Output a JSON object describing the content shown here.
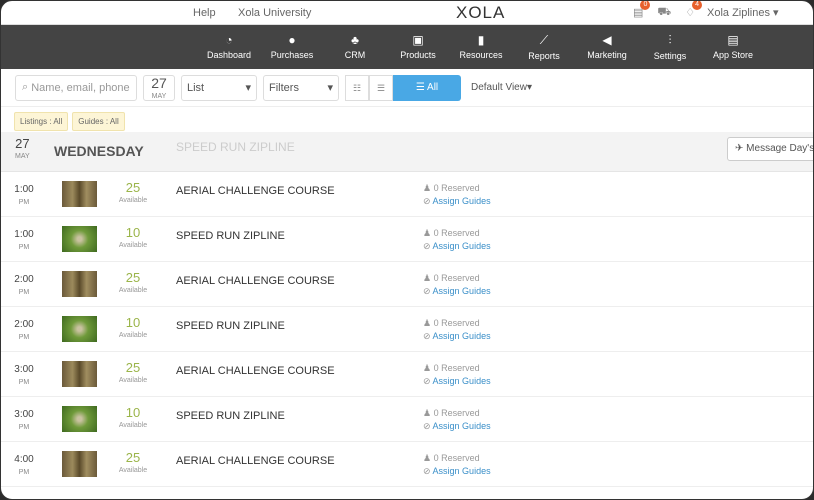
{
  "topbar": {
    "help": "Help",
    "university": "Xola University",
    "logo": "XOLA",
    "badges": [
      "0",
      "4"
    ],
    "account": "Xola Ziplines ▾"
  },
  "nav": [
    {
      "label": "Dashboard",
      "icon": "◔"
    },
    {
      "label": "Purchases",
      "icon": "●"
    },
    {
      "label": "CRM",
      "icon": "♣"
    },
    {
      "label": "Products",
      "icon": "▣"
    },
    {
      "label": "Resources",
      "icon": "▮"
    },
    {
      "label": "Reports",
      "icon": "⟋"
    },
    {
      "label": "Marketing",
      "icon": "◀"
    },
    {
      "label": "Settings",
      "icon": "⫶"
    },
    {
      "label": "App Store",
      "icon": "▤"
    }
  ],
  "toolbar": {
    "search_placeholder": "Name, email, phone",
    "date_day": "27",
    "date_month": "MAY",
    "view": "List",
    "filters": "Filters",
    "all": "All",
    "default_view": "Default View▾"
  },
  "chips": [
    "Listings : All",
    "Guides : All"
  ],
  "day": {
    "day": "27",
    "month": "MAY",
    "weekday": "WEDNESDAY",
    "ghost": "SPEED RUN ZIPLINE",
    "message": "Message Day's B"
  },
  "rows": [
    {
      "time": "1:00",
      "ampm": "PM",
      "avail": "25",
      "avail_label": "Available",
      "name": "AERIAL CHALLENGE COURSE",
      "reserved": "0 Reserved",
      "assign": "Assign Guides",
      "type": "aerial"
    },
    {
      "time": "1:00",
      "ampm": "PM",
      "avail": "10",
      "avail_label": "Available",
      "name": "SPEED RUN ZIPLINE",
      "reserved": "0 Reserved",
      "assign": "Assign Guides",
      "type": "zip"
    },
    {
      "time": "2:00",
      "ampm": "PM",
      "avail": "25",
      "avail_label": "Available",
      "name": "AERIAL CHALLENGE COURSE",
      "reserved": "0 Reserved",
      "assign": "Assign Guides",
      "type": "aerial"
    },
    {
      "time": "2:00",
      "ampm": "PM",
      "avail": "10",
      "avail_label": "Available",
      "name": "SPEED RUN ZIPLINE",
      "reserved": "0 Reserved",
      "assign": "Assign Guides",
      "type": "zip"
    },
    {
      "time": "3:00",
      "ampm": "PM",
      "avail": "25",
      "avail_label": "Available",
      "name": "AERIAL CHALLENGE COURSE",
      "reserved": "0 Reserved",
      "assign": "Assign Guides",
      "type": "aerial"
    },
    {
      "time": "3:00",
      "ampm": "PM",
      "avail": "10",
      "avail_label": "Available",
      "name": "SPEED RUN ZIPLINE",
      "reserved": "0 Reserved",
      "assign": "Assign Guides",
      "type": "zip"
    },
    {
      "time": "4:00",
      "ampm": "PM",
      "avail": "25",
      "avail_label": "Available",
      "name": "AERIAL CHALLENGE COURSE",
      "reserved": "0 Reserved",
      "assign": "Assign Guides",
      "type": "aerial"
    }
  ]
}
